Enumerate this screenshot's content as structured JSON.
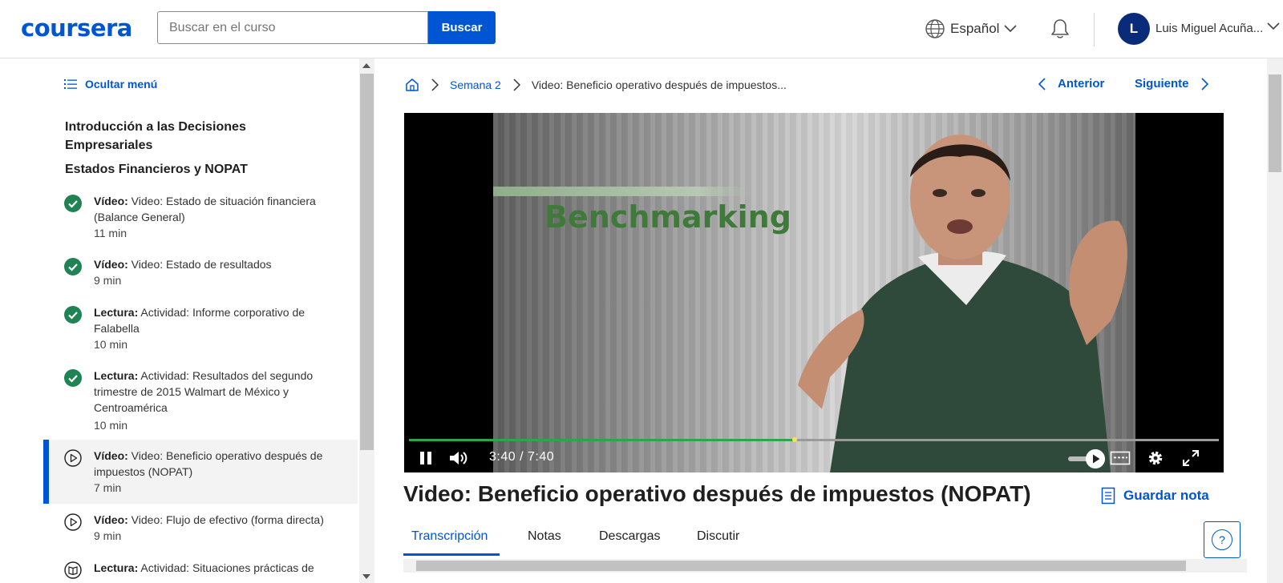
{
  "header": {
    "logo": "coursera",
    "search_placeholder": "Buscar en el curso",
    "search_button": "Buscar",
    "language": "Español",
    "avatar_initial": "L",
    "user_name": "Luis Miguel Acuña..."
  },
  "sidebar": {
    "hide_menu": "Ocultar menú",
    "course_title": "Introducción a las Decisiones Empresariales",
    "section_title": "Estados Financieros y NOPAT",
    "items": [
      {
        "type": "Vídeo:",
        "title": "Video: Estado de situación financiera (Balance General)",
        "duration": "11 min",
        "status": "completed"
      },
      {
        "type": "Vídeo:",
        "title": "Video: Estado de resultados",
        "duration": "9 min",
        "status": "completed"
      },
      {
        "type": "Lectura:",
        "title": "Actividad: Informe corporativo de Falabella",
        "duration": "10 min",
        "status": "completed"
      },
      {
        "type": "Lectura:",
        "title": "Actividad: Resultados del segundo trimestre de 2015 Walmart de México y Centroamérica",
        "duration": "10 min",
        "status": "completed"
      },
      {
        "type": "Vídeo:",
        "title": "Video: Beneficio operativo después de impuestos (NOPAT)",
        "duration": "7 min",
        "status": "current"
      },
      {
        "type": "Vídeo:",
        "title": "Video: Flujo de efectivo (forma directa)",
        "duration": "9 min",
        "status": "pending"
      },
      {
        "type": "Lectura:",
        "title": "Actividad: Situaciones prácticas de",
        "duration": "",
        "status": "pending"
      }
    ]
  },
  "breadcrumb": {
    "week": "Semana 2",
    "current": "Video: Beneficio operativo después de impuestos..."
  },
  "nav": {
    "prev": "Anterior",
    "next": "Siguiente"
  },
  "player": {
    "caption": "Benchmarking",
    "current_time": "3:40",
    "separator": "/",
    "total_time": "7:40",
    "progress_fraction": 0.476,
    "buffered_fraction": 0.475
  },
  "lecture": {
    "title": "Video: Beneficio operativo después de impuestos (NOPAT)",
    "save_note": "Guardar nota",
    "tabs": [
      "Transcripción",
      "Notas",
      "Descargas",
      "Discutir"
    ],
    "active_tab": 0
  },
  "colors": {
    "brand": "#0056d2",
    "completed": "#1f8354",
    "progress": "#2ea44f"
  },
  "icons": {
    "language": "globe-icon",
    "notifications": "bell-icon",
    "help": "question-icon"
  }
}
